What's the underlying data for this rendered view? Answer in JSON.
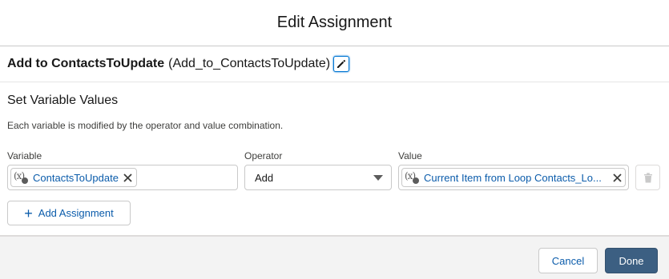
{
  "modal": {
    "title": "Edit Assignment"
  },
  "element": {
    "label": "Add to ContactsToUpdate",
    "api_name": "(Add_to_ContactsToUpdate)"
  },
  "section": {
    "title": "Set Variable Values",
    "description": "Each variable is modified by the operator and value combination."
  },
  "columns": {
    "variable": "Variable",
    "operator": "Operator",
    "value": "Value"
  },
  "row": {
    "variable": "ContactsToUpdate",
    "operator": "Add",
    "value": "Current Item from Loop Contacts_Lo..."
  },
  "actions": {
    "add_assignment": "Add Assignment",
    "cancel": "Cancel",
    "done": "Done"
  },
  "icons": {
    "variable": "variable-icon",
    "edit": "pencil-icon",
    "remove": "close-icon",
    "delete": "trash-icon",
    "add": "plus-icon",
    "dropdown": "chevron-down-icon"
  },
  "colors": {
    "brand": "#3c5f82",
    "link": "#0b5cab",
    "focus": "#0176d3"
  }
}
